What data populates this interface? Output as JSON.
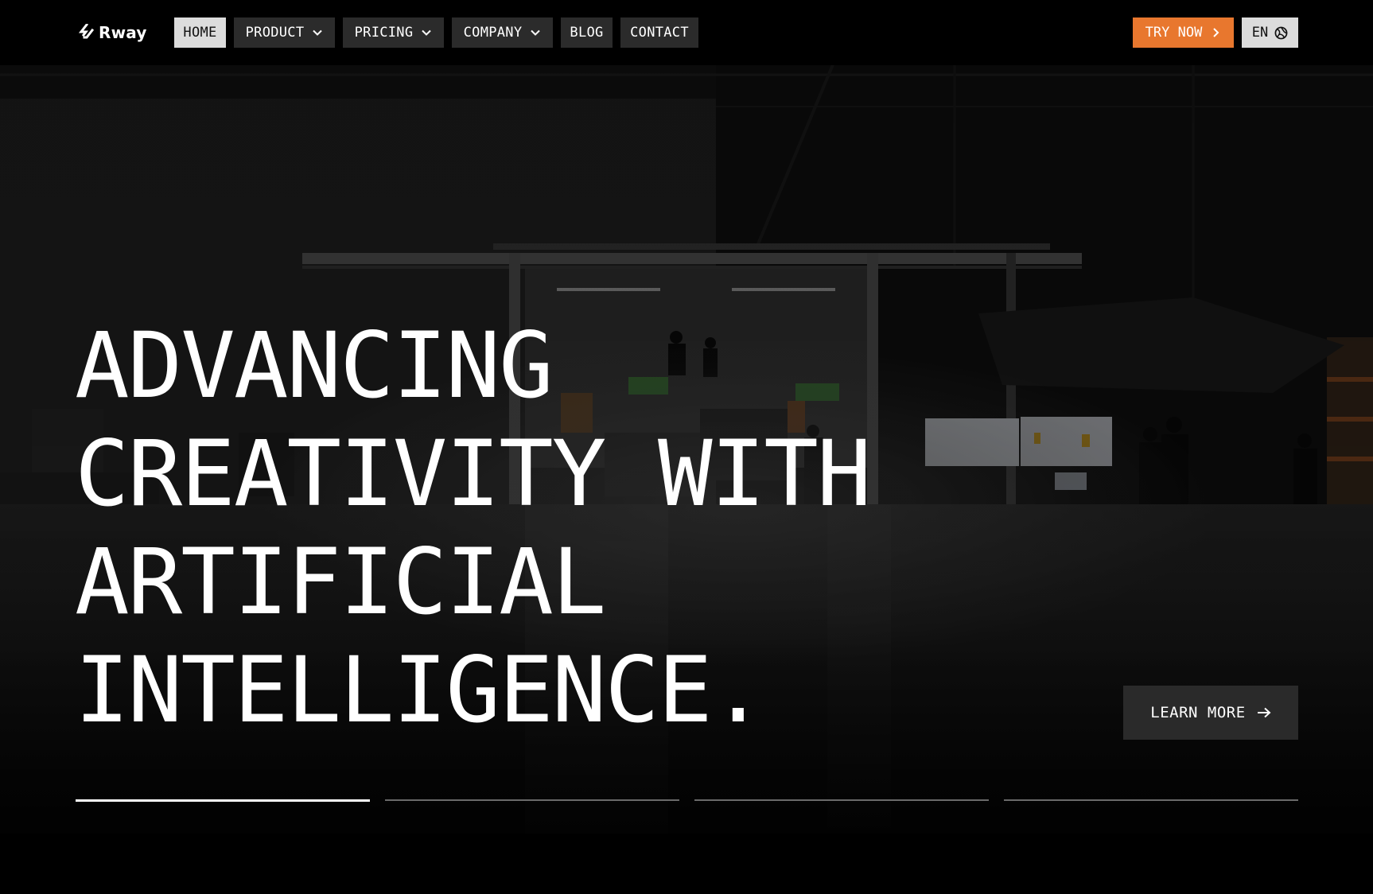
{
  "brand": {
    "name": "Rway",
    "accent_color": "#e8772e"
  },
  "nav": {
    "items": [
      {
        "label": "HOME",
        "active": true,
        "has_dropdown": false
      },
      {
        "label": "PRODUCT",
        "active": false,
        "has_dropdown": true
      },
      {
        "label": "PRICING",
        "active": false,
        "has_dropdown": true
      },
      {
        "label": "COMPANY",
        "active": false,
        "has_dropdown": true
      },
      {
        "label": "BLOG",
        "active": false,
        "has_dropdown": false
      },
      {
        "label": "CONTACT",
        "active": false,
        "has_dropdown": false
      }
    ],
    "cta_label": "TRY NOW",
    "cta_icon": "chevron-right-icon",
    "language_label": "EN",
    "language_icon": "globe-icon"
  },
  "hero": {
    "headline_lines": [
      "ADVANCING",
      "CREATIVITY WITH",
      "ARTIFICIAL",
      "INTELLIGENCE."
    ],
    "learn_more_label": "LEARN MORE",
    "learn_more_icon": "arrow-right-icon",
    "background_description_icon": "hero-photo",
    "slides": {
      "count": 4,
      "active_index": 0
    }
  }
}
